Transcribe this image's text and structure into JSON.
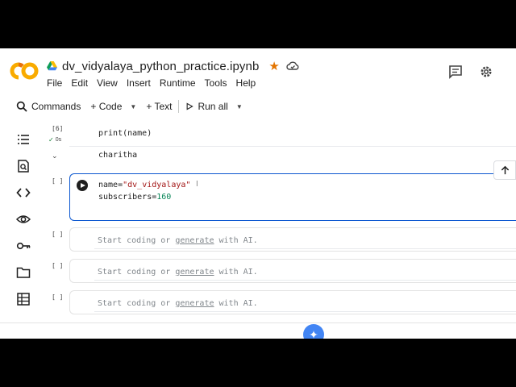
{
  "app": {
    "notebook_title": "dv_vidyalaya_python_practice.ipynb",
    "colors": {
      "accent": "#0b57d0",
      "logo_orange": "#f9ab00",
      "star": "#e37400"
    }
  },
  "menu": {
    "items": [
      "File",
      "Edit",
      "View",
      "Insert",
      "Runtime",
      "Tools",
      "Help"
    ]
  },
  "toolbar": {
    "commands_label": "Commands",
    "code_label": "+ Code",
    "text_label": "+ Text",
    "run_all_label": "Run all"
  },
  "cells": {
    "cell1": {
      "exec_count": "[6]",
      "status_time": "0s",
      "code": "print(name)",
      "output": "charitha"
    },
    "cell2": {
      "exec_count": "[ ]",
      "line1_var": "name=",
      "line1_str": "\"dv_vidyalaya\"",
      "line2_var": "subscribers=",
      "line2_num": "160"
    },
    "empty": [
      {
        "exec_count": "[ ]",
        "prefix": "Start coding or ",
        "link": "generate",
        "suffix": " with AI."
      },
      {
        "exec_count": "[ ]",
        "prefix": "Start coding or ",
        "link": "generate",
        "suffix": " with AI."
      },
      {
        "exec_count": "[ ]",
        "prefix": "Start coding or ",
        "link": "generate",
        "suffix": " with AI."
      }
    ]
  }
}
